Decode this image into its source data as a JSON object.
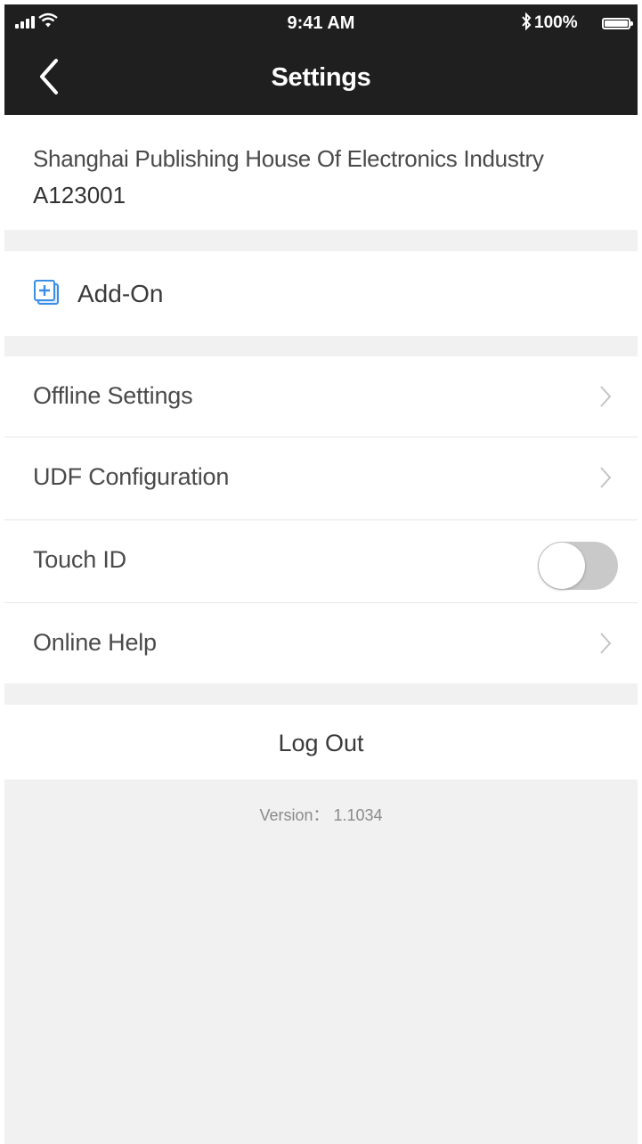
{
  "status_bar": {
    "time": "9:41 AM",
    "battery_percent": "100%",
    "icons": [
      "signal-icon",
      "wifi-icon",
      "bluetooth-icon",
      "battery-icon"
    ]
  },
  "nav": {
    "title": "Settings",
    "back_icon": "chevron-left-icon"
  },
  "account": {
    "company": "Shanghai Publishing House Of Electronics Industry",
    "id": "A123001"
  },
  "addon": {
    "label": "Add-On",
    "icon": "add-square-icon",
    "icon_color": "#3a8ee6"
  },
  "settings": {
    "offline_settings": "Offline Settings",
    "udf_configuration": "UDF Configuration",
    "touch_id": "Touch ID",
    "touch_id_enabled": false,
    "online_help": "Online Help"
  },
  "logout_label": "Log Out",
  "version_label": "Version： 1.1034",
  "colors": {
    "header_bg": "#1f1f1f",
    "page_bg": "#f1f1f1",
    "accent": "#3a8ee6",
    "toggle_off": "#c9c9c9"
  }
}
